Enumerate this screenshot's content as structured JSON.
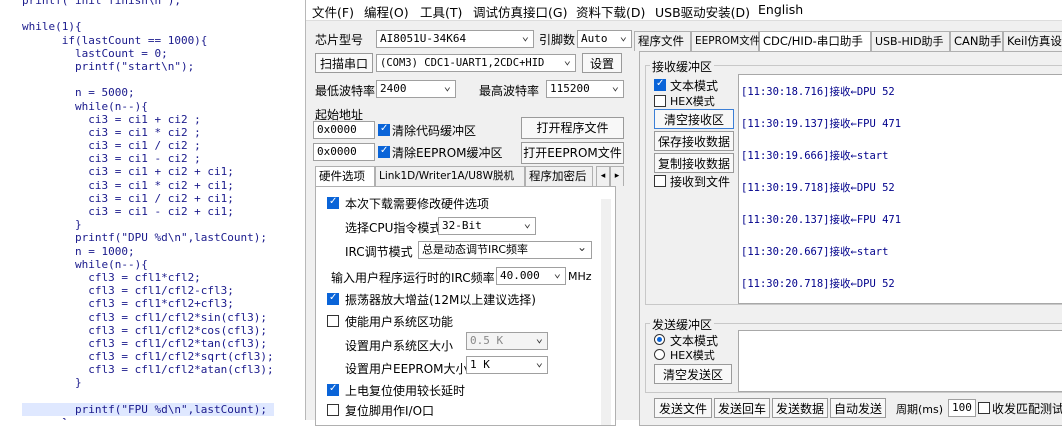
{
  "code_lines": [
    "printf(\"init finish\\n\");",
    "",
    "while(1){",
    "      if(lastCount == 1000){",
    "        lastCount = 0;",
    "        printf(\"start\\n\");",
    "",
    "        n = 5000;",
    "        while(n--){",
    "          ci3 = ci1 + ci2 ;",
    "          ci3 = ci1 * ci2 ;",
    "          ci3 = ci1 / ci2 ;",
    "          ci3 = ci1 - ci2 ;",
    "          ci3 = ci1 + ci2 + ci1;",
    "          ci3 = ci1 * ci2 + ci1;",
    "          ci3 = ci1 / ci2 + ci1;",
    "          ci3 = ci1 - ci2 + ci1;",
    "        }",
    "        printf(\"DPU %d\\n\",lastCount);",
    "        n = 1000;",
    "        while(n--){",
    "          cfl3 = cfl1*cfl2;",
    "          cfl3 = cfl1/cfl2-cfl3;",
    "          cfl3 = cfl1*cfl2+cfl3;",
    "          cfl3 = cfl1/cfl2*sin(cfl3);",
    "          cfl3 = cfl1/cfl2*cos(cfl3);",
    "          cfl3 = cfl1/cfl2*tan(cfl3);",
    "          cfl3 = cfl1/cfl2*sqrt(cfl3);",
    "          cfl3 = cfl1/cfl2*atan(cfl3);",
    "        }",
    "",
    "        printf(\"FPU %d\\n\",lastCount);",
    "      }"
  ],
  "menu": [
    "文件(F)",
    "编程(O)",
    "工具(T)",
    "调试仿真接口(G)",
    "资料下载(D)",
    "USB驱动安装(D)",
    "English"
  ],
  "left": {
    "chip_label": "芯片型号",
    "chip_value": "AI8051U-34K64",
    "pins_label": "引脚数",
    "pins_value": "Auto",
    "scan_label": "扫描串口",
    "port_value": "(COM3) CDC1-UART1,2CDC+HID",
    "settings_label": "设置",
    "min_baud_label": "最低波特率",
    "min_baud_value": "2400",
    "max_baud_label": "最高波特率",
    "max_baud_value": "115200",
    "start_addr_label": "起始地址",
    "addr1": "0x0000",
    "clear_code_label": "清除代码缓冲区",
    "open_prog_label": "打开程序文件",
    "addr2": "0x0000",
    "clear_eeprom_label": "清除EEPROM缓冲区",
    "open_eeprom_label": "打开EEPROM文件",
    "tabs": [
      "硬件选项",
      "Link1D/Writer1A/U8W脱机",
      "程序加密后"
    ],
    "options": {
      "need_modify": "本次下载需要修改硬件选项",
      "cpu_mode_label": "选择CPU指令模式",
      "cpu_mode_value": "32-Bit",
      "irc_mode_label": "IRC调节模式",
      "irc_mode_value": "总是动态调节IRC频率",
      "irc_freq_label": "输入用户程序运行时的IRC频率",
      "irc_freq_value": "40.000",
      "irc_freq_unit": "MHz",
      "osc_gain": "振荡器放大增益(12M以上建议选择)",
      "user_sys_area": "使能用户系统区功能",
      "sys_area_size_label": "设置用户系统区大小",
      "sys_area_size_value": "0.5 K",
      "eeprom_size_label": "设置用户EEPROM大小",
      "eeprom_size_value": "1   K",
      "long_reset": "上电复位使用较长延时",
      "reset_io": "复位脚用作I/O口"
    }
  },
  "right": {
    "tabs": [
      "程序文件",
      "EEPROM文件",
      "CDC/HID-串口助手",
      "USB-HID助手",
      "CAN助手",
      "Keil仿真设"
    ],
    "rx_title": "接收缓冲区",
    "text_mode": "文本模式",
    "hex_mode": "HEX模式",
    "clear_rx": "清空接收区",
    "save_rx": "保存接收数据",
    "copy_rx": "复制接收数据",
    "rx_to_file": "接收到文件",
    "rx_lines": [
      "[11:30:18.716]接收←DPU 52",
      "[11:30:19.137]接收←FPU 471",
      "[11:30:19.666]接收←start",
      "[11:30:19.718]接收←DPU 52",
      "[11:30:20.137]接收←FPU 471",
      "[11:30:20.667]接收←start",
      "[11:30:20.718]接收←DPU 52"
    ],
    "tx_title": "发送缓冲区",
    "tx_text_mode": "文本模式",
    "tx_hex_mode": "HEX模式",
    "clear_tx": "清空发送区",
    "bottom": {
      "send_file": "发送文件",
      "send_enter": "发送回车",
      "send_data": "发送数据",
      "auto_send": "自动发送",
      "period_label": "周期(ms)",
      "period_value": "100",
      "match_label": "收发匹配测试"
    }
  }
}
